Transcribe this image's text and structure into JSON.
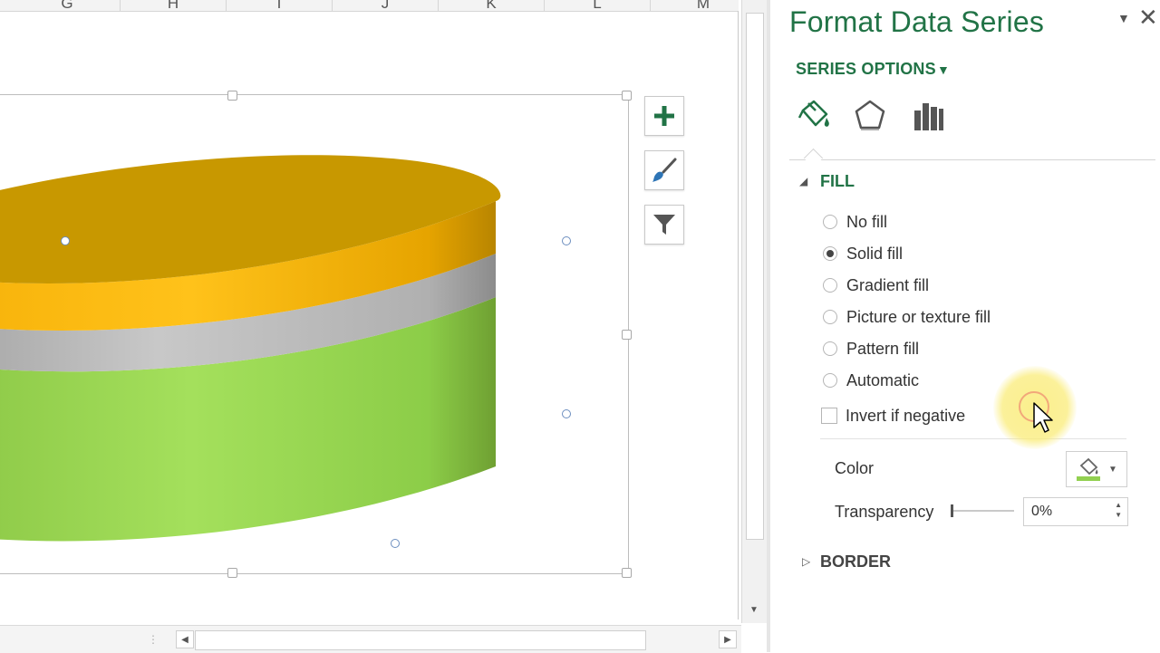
{
  "sheet": {
    "columns": [
      "G",
      "H",
      "I",
      "J",
      "K",
      "L",
      "M"
    ]
  },
  "chart": {
    "series_colors": {
      "top": "#c89800",
      "middle": "#a7a7a7",
      "bottom": "#92d050"
    }
  },
  "chart_buttons": [
    {
      "name": "add-chart-element-button",
      "icon": "plus-icon"
    },
    {
      "name": "chart-styles-button",
      "icon": "paintbrush-icon"
    },
    {
      "name": "chart-filters-button",
      "icon": "filter-icon"
    }
  ],
  "pane": {
    "title": "Format Data Series",
    "close_label": "✕",
    "series_options_label": "SERIES OPTIONS",
    "tabs": [
      "fill-line-icon",
      "effects-icon",
      "series-options-icon"
    ],
    "fill": {
      "heading": "FILL",
      "options": [
        {
          "label": "No fill",
          "selected": false
        },
        {
          "label": "Solid fill",
          "selected": true
        },
        {
          "label": "Gradient fill",
          "selected": false
        },
        {
          "label": "Picture or texture fill",
          "selected": false
        },
        {
          "label": "Pattern fill",
          "selected": false
        },
        {
          "label": "Automatic",
          "selected": false
        }
      ],
      "invert_label": "Invert if negative",
      "color_label": "Color",
      "color_value": "#92d050",
      "transparency_label": "Transparency",
      "transparency_value": "0%"
    },
    "border": {
      "heading": "BORDER"
    }
  },
  "accent": "#217346"
}
